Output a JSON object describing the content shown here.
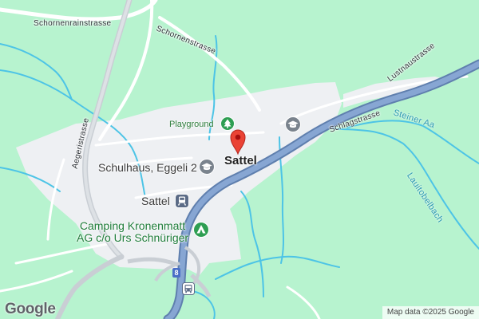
{
  "map": {
    "town_label": "Sattel",
    "streets": {
      "schornenrainstrasse": "Schornenrainstrasse",
      "schornenstrasse": "Schornenstrasse",
      "aegeristrasse": "Aegeristrasse",
      "schlagstrasse": "Schlagstrasse",
      "lustnaustrasse": "Lustnaustrasse"
    },
    "waterways": {
      "steiner_aa": "Steiner Aa",
      "lauitobelbach": "Lauitobelbach"
    },
    "pois": {
      "playground": "Playground",
      "school": "Schulhaus, Eggeli 2",
      "station": "Sattel",
      "camping_line1": "Camping Kronenmatt",
      "camping_line2": "AG c/o Urs Schnüriger"
    },
    "route_shield": "8",
    "logo": "Google",
    "attribution": "Map data ©2025 Google"
  },
  "colors": {
    "terrain": "#b7f3cf",
    "urban": "#eef0f3",
    "highway": "#7c9dc8",
    "water": "#4dc4e6",
    "road": "#ffffff",
    "park_poi": "#2e9e52",
    "marker": "#ea4335"
  },
  "icons": [
    "tree-icon",
    "graduation-cap-icon",
    "train-icon",
    "tent-icon",
    "bus-icon",
    "map-pin-icon"
  ]
}
